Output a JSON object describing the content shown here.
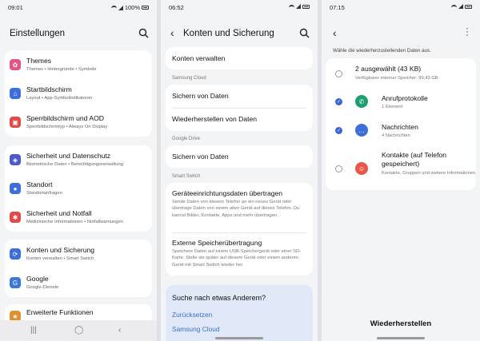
{
  "colors": {
    "accent": "#3b6fd6",
    "background": "#f3f4f6",
    "card": "#ffffff"
  },
  "screen1": {
    "status": {
      "time": "09:01",
      "battery": "100%"
    },
    "title": "Einstellungen",
    "search_icon": "search-icon",
    "items": [
      {
        "title": "Themes",
        "subtitle": "Themes • Hintergründe • Symbole",
        "icon": "palette-icon",
        "color": "#e25581"
      },
      {
        "title": "Startbildschirm",
        "subtitle": "Layout • App-Symbolindikatoren",
        "icon": "home-icon",
        "color": "#3c6fd9"
      },
      {
        "title": "Sperrbildschirm und AOD",
        "subtitle": "Sperrbildschirmtyp • Always On Display",
        "icon": "lock-icon",
        "color": "#e24a4a"
      },
      {
        "title": "Sicherheit und Datenschutz",
        "subtitle": "Biometrische Daten • Berechtigungsverwaltung",
        "icon": "shield-icon",
        "color": "#4d58c9"
      },
      {
        "title": "Standort",
        "subtitle": "Standortanfragen",
        "icon": "location-icon",
        "color": "#3c6fd9"
      },
      {
        "title": "Sicherheit und Notfall",
        "subtitle": "Medizinische Informationen • Notfallwarnungen",
        "icon": "emergency-icon",
        "color": "#e24a4a"
      },
      {
        "title": "Konten und Sicherung",
        "subtitle": "Konten verwalten • Smart Switch",
        "icon": "sync-icon",
        "color": "#3c6fd9"
      },
      {
        "title": "Google",
        "subtitle": "Google-Dienste",
        "icon": "google-icon",
        "color": "#3c78d8"
      },
      {
        "title": "Erweiterte Funktionen",
        "subtitle": "",
        "icon": "star-icon",
        "color": "#e0902f"
      }
    ]
  },
  "screen2": {
    "status": {
      "time": "06:52"
    },
    "title": "Konten und Sicherung",
    "manage": "Konten verwalten",
    "sections": {
      "samsung_cloud": "Samsung Cloud",
      "google_drive": "Google Drive",
      "smart_switch": "Smart Switch"
    },
    "backup": "Sichern von Daten",
    "restore": "Wiederherstellen von Daten",
    "drive_backup": "Sichern von Daten",
    "transfer_title": "Geräteeinrichtungsdaten übertragen",
    "transfer_desc": "Sende Daten von diesem Telefon an ein neues Gerät oder übertrage Daten von einem alten Gerät auf dieses Telefon. Du kannst Bilder, Kontakte, Apps und mehr übertragen.",
    "external_title": "Externe Speicherübertragung",
    "external_desc": "Speichere Daten auf einem USB-Speichergerät oder einer SD-Karte. Stelle sie später auf diesem Gerät oder einem anderen Gerät mit Smart Switch wieder her.",
    "suggest": {
      "title": "Suche nach etwas Anderem?",
      "link1": "Zurücksetzen",
      "link2": "Samsung Cloud"
    }
  },
  "screen3": {
    "status": {
      "time": "07:15"
    },
    "instruction": "Wähle die wiederherzustellenden Daten aus.",
    "summary": {
      "title": "2 ausgewählt (43 KB)",
      "subtitle": "Verfügbarer interner Speicher: 99,43 GB",
      "checked": false
    },
    "items": [
      {
        "title": "Anrufprotokolle",
        "subtitle": "1 Element",
        "checked": true,
        "icon": "phone-icon",
        "color": "#1d9e6e"
      },
      {
        "title": "Nachrichten",
        "subtitle": "4 Nachrichten",
        "checked": true,
        "icon": "message-icon",
        "color": "#3c6fd9"
      },
      {
        "title": "Kontakte (auf Telefon gespeichert)",
        "subtitle": "Kontakte, Gruppen und weitere Informationen",
        "checked": false,
        "icon": "contacts-icon",
        "color": "#e8584a"
      }
    ],
    "restore_button": "Wiederherstellen"
  }
}
